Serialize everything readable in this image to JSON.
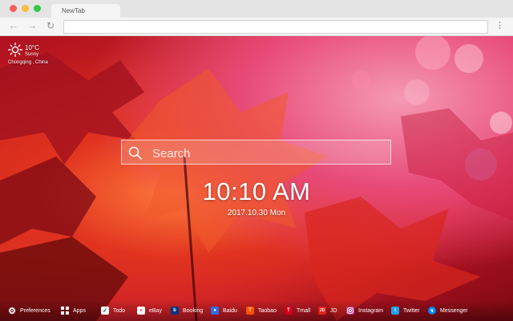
{
  "browser": {
    "tab_title": "NewTab"
  },
  "weather": {
    "temperature": "10°C",
    "condition": "Sunny",
    "location": "Chongqing , China",
    "icon": "sun-icon"
  },
  "search": {
    "placeholder": "Search"
  },
  "clock": {
    "time": "10:10 AM",
    "date": "2017.10.30 Mon"
  },
  "bottom_bar": {
    "links": [
      {
        "label": "Preferences",
        "icon": "gear-icon"
      },
      {
        "label": "Apps",
        "icon": "apps-grid-icon"
      },
      {
        "label": "Todo",
        "icon": "todo-check-icon"
      },
      {
        "label": "eBay",
        "icon": "ebay-icon"
      },
      {
        "label": "Booking",
        "icon": "booking-icon"
      },
      {
        "label": "Baidu",
        "icon": "baidu-icon"
      },
      {
        "label": "Taobao",
        "icon": "taobao-icon"
      },
      {
        "label": "Tmall",
        "icon": "tmall-icon"
      },
      {
        "label": "JD",
        "icon": "jd-icon"
      },
      {
        "label": "Instagram",
        "icon": "instagram-icon"
      },
      {
        "label": "Twitter",
        "icon": "twitter-icon"
      },
      {
        "label": "Messenger",
        "icon": "messenger-icon"
      }
    ]
  },
  "colors": {
    "booking": "#003580",
    "baidu": "#2f6ce5",
    "taobao": "#ff5000",
    "tmall": "#d0021b",
    "jd": "#e1251b",
    "instagram": "#c13584",
    "twitter": "#1da1f2",
    "messenger": "#0084ff"
  }
}
